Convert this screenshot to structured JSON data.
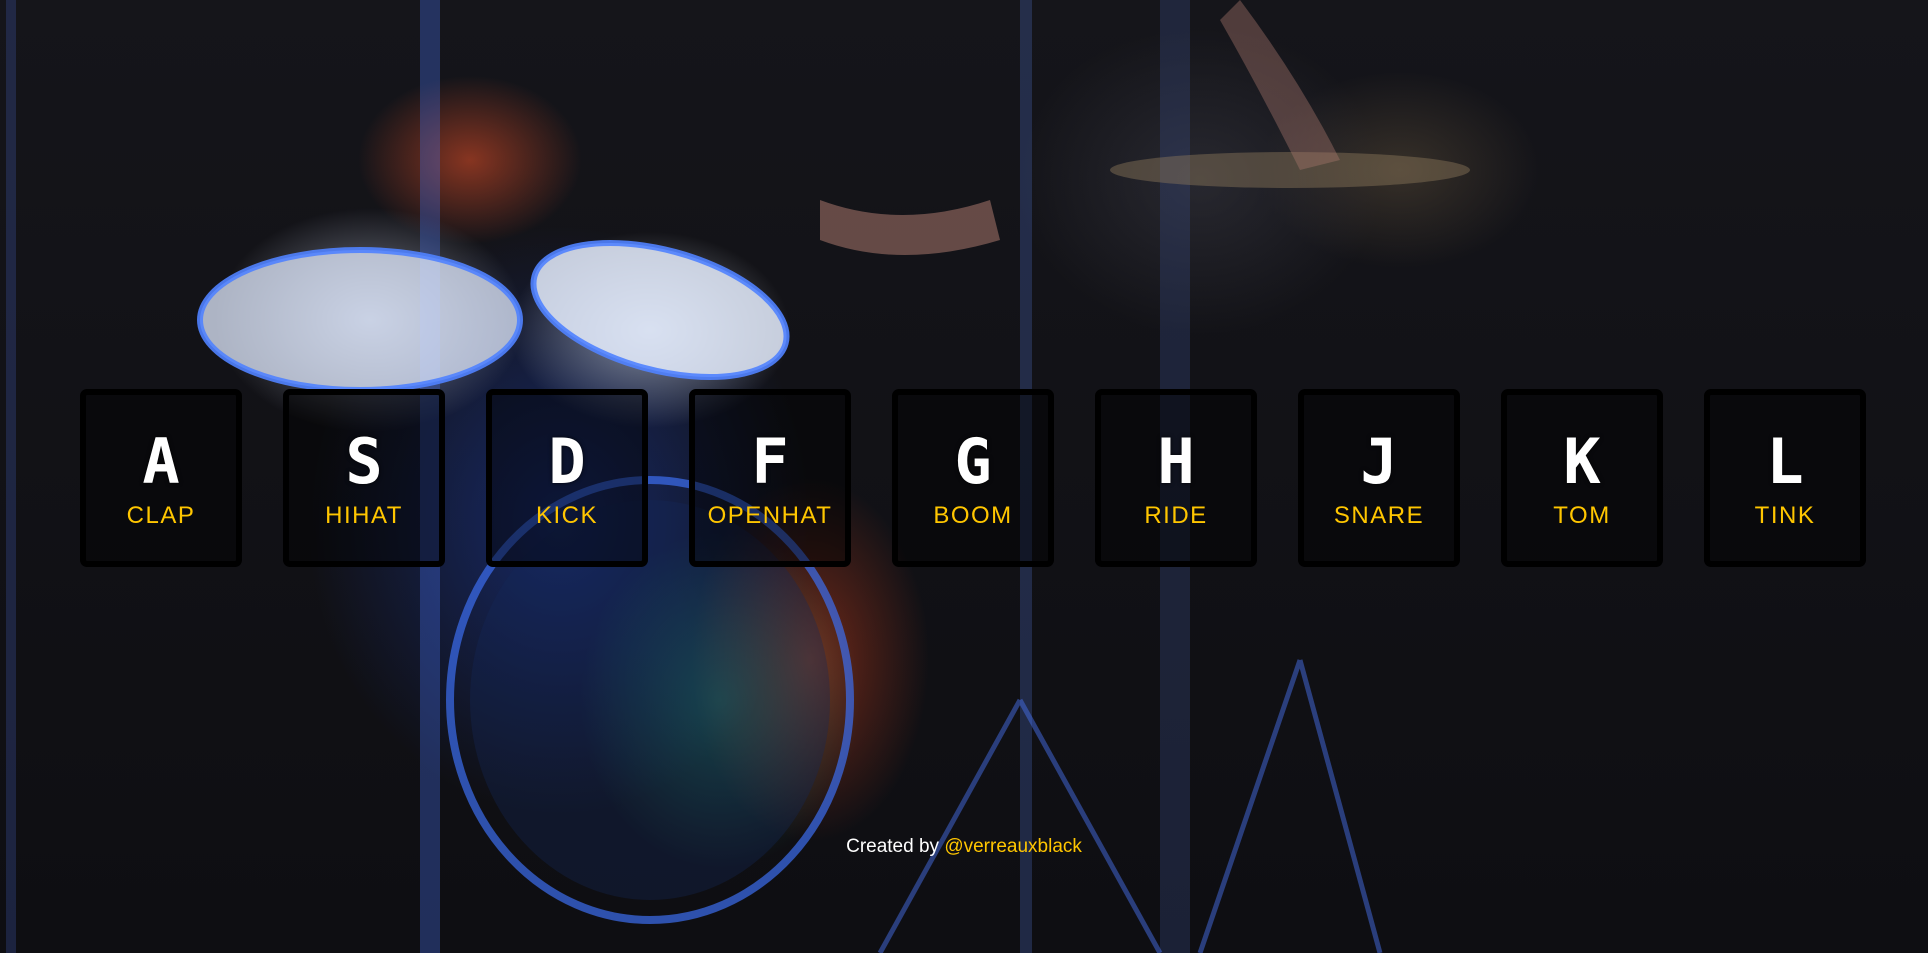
{
  "keys": [
    {
      "letter": "A",
      "sound": "CLAP"
    },
    {
      "letter": "S",
      "sound": "HIHAT"
    },
    {
      "letter": "D",
      "sound": "KICK"
    },
    {
      "letter": "F",
      "sound": "OPENHAT"
    },
    {
      "letter": "G",
      "sound": "BOOM"
    },
    {
      "letter": "H",
      "sound": "RIDE"
    },
    {
      "letter": "J",
      "sound": "SNARE"
    },
    {
      "letter": "K",
      "sound": "TOM"
    },
    {
      "letter": "L",
      "sound": "TINK"
    }
  ],
  "footer": {
    "prefix": "Created by",
    "author_link": "@verreauxblack"
  },
  "colors": {
    "accent": "#ffc600",
    "key_border": "#000000",
    "text": "#ffffff"
  }
}
